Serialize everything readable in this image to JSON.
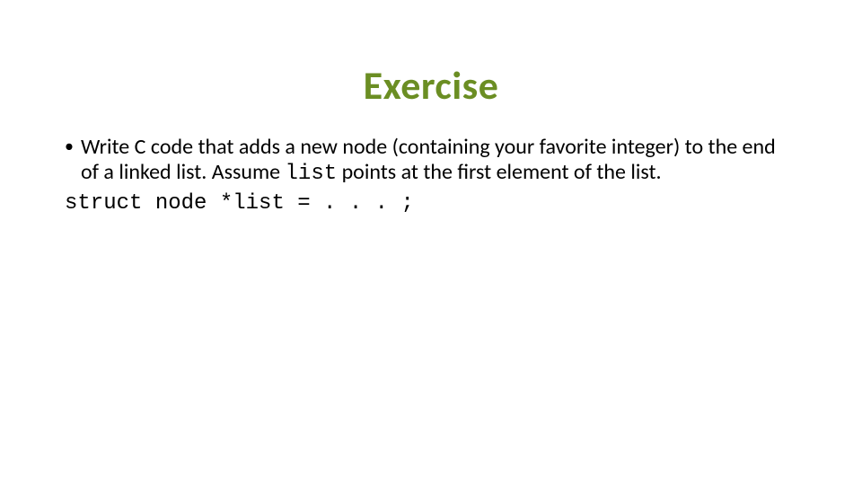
{
  "title": "Exercise",
  "bullet": {
    "marker": "•",
    "text_before": "Write C code that adds a new node (containing your favorite integer) to the end of a linked list. Assume ",
    "code_word": "list",
    "text_after": " points at the first element of the list."
  },
  "codeline": "struct node *list = . . . ;"
}
